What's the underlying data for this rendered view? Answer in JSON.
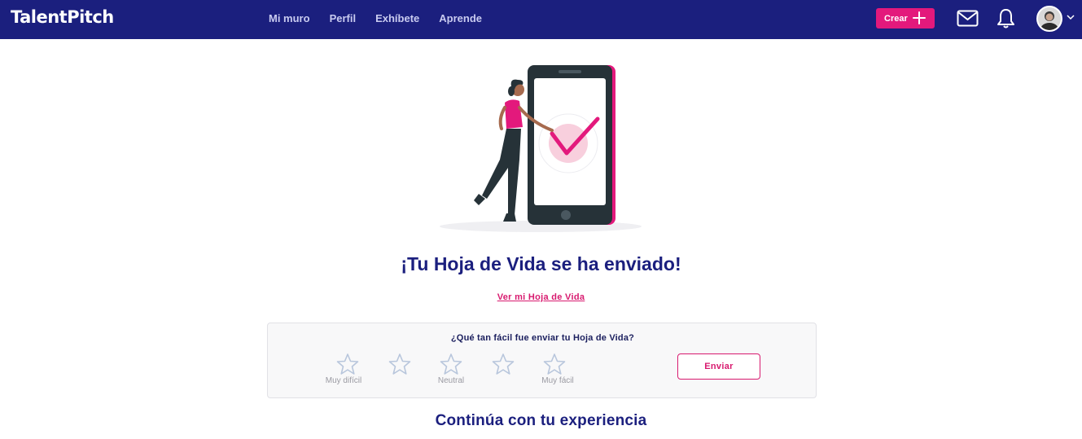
{
  "header": {
    "logo": "TalentPitch",
    "nav": [
      "Mi muro",
      "Perfil",
      "Exhíbete",
      "Aprende"
    ],
    "create_label": "Crear"
  },
  "main": {
    "heading": "¡Tu Hoja de Vida se ha enviado!",
    "cv_link": "Ver mi Hoja de Vida",
    "rating": {
      "question": "¿Qué tan fácil fue enviar tu Hoja de Vida?",
      "stars": 5,
      "labels": [
        "Muy difícil",
        "Neutral",
        "Muy fácil"
      ],
      "submit_label": "Enviar"
    },
    "subheading": "Continúa con tu experiencia"
  },
  "colors": {
    "brand_navy": "#1b1f7e",
    "accent_pink": "#e3197c",
    "star_outline": "#b8c6dc"
  },
  "icons": [
    "plus-icon",
    "mail-icon",
    "bell-icon",
    "chevron-down-icon",
    "star-icon"
  ]
}
